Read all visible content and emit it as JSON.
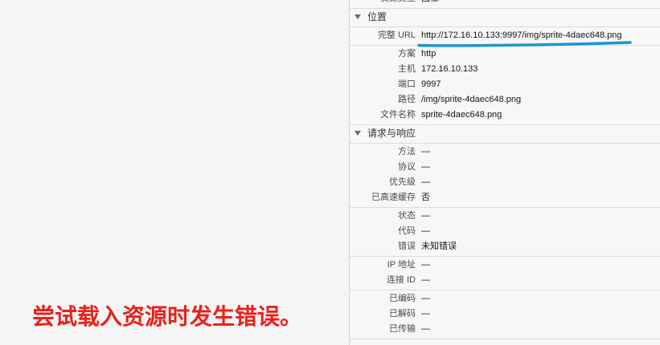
{
  "error_message": "尝试载入资源时发生错误。",
  "colors": {
    "error_text": "#e8221c",
    "annotation_underline": "#1c95d1",
    "panel_background": "#f7f7f7",
    "separator": "#dcdcdc"
  },
  "icons": {
    "section_disclosure": "triangle-down-expanded"
  },
  "inspector": {
    "summary_rows": [
      {
        "label": "资源类型",
        "value": "图像"
      }
    ],
    "sections": [
      {
        "title": "位置",
        "groups": [
          {
            "rows": [
              {
                "label": "完整 URL",
                "value": "http://172.16.10.133:9997/img/sprite-4daec648.png"
              }
            ]
          },
          {
            "rows": [
              {
                "label": "方案",
                "value": "http"
              },
              {
                "label": "主机",
                "value": "172.16.10.133"
              },
              {
                "label": "端口",
                "value": "9997"
              },
              {
                "label": "路径",
                "value": "/img/sprite-4daec648.png"
              },
              {
                "label": "文件名称",
                "value": "sprite-4daec648.png"
              }
            ]
          }
        ]
      },
      {
        "title": "请求与响应",
        "groups": [
          {
            "rows": [
              {
                "label": "方法",
                "value": "—"
              },
              {
                "label": "协议",
                "value": "—"
              },
              {
                "label": "优先级",
                "value": "—"
              },
              {
                "label": "已高速缓存",
                "value": "否"
              }
            ]
          },
          {
            "rows": [
              {
                "label": "状态",
                "value": "—"
              },
              {
                "label": "代码",
                "value": "—"
              },
              {
                "label": "错误",
                "value": "未知错误"
              }
            ]
          },
          {
            "rows": [
              {
                "label": "IP 地址",
                "value": "—"
              },
              {
                "label": "连接 ID",
                "value": "—"
              }
            ]
          },
          {
            "rows": [
              {
                "label": "已编码",
                "value": "—"
              },
              {
                "label": "已解码",
                "value": "—"
              },
              {
                "label": "已传输",
                "value": "—"
              }
            ]
          }
        ]
      }
    ]
  }
}
